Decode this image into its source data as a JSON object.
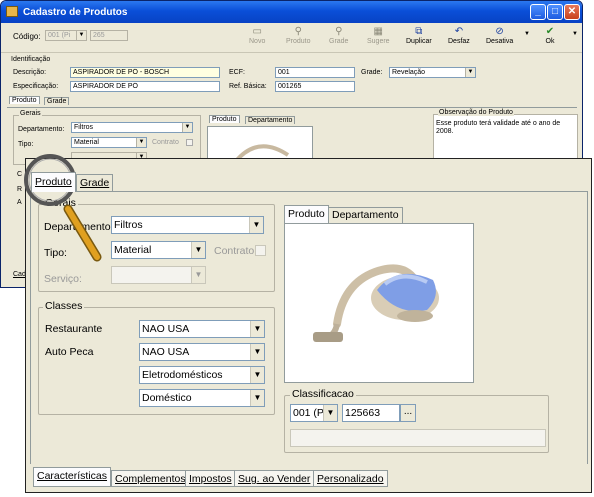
{
  "window": {
    "title": "Cadastro de Produtos",
    "min": "_",
    "max": "□",
    "close": "✕"
  },
  "toolbar": {
    "codigo_label": "Código:",
    "codigo_value": "001 (Pi",
    "codigo_num": "265",
    "buttons": [
      {
        "label": "Novo",
        "icon": "new-icon",
        "enabled": false
      },
      {
        "label": "Produto",
        "icon": "search-icon",
        "enabled": false
      },
      {
        "label": "Grade",
        "icon": "search-icon",
        "enabled": false
      },
      {
        "label": "Sugere",
        "icon": "grid-icon",
        "enabled": false
      },
      {
        "label": "Duplicar",
        "icon": "copy-icon",
        "enabled": true
      },
      {
        "label": "Desfaz",
        "icon": "undo-icon",
        "enabled": true
      },
      {
        "label": "Desativa",
        "icon": "disable-icon",
        "enabled": true
      },
      {
        "label": "Ok",
        "icon": "ok-icon",
        "enabled": true
      }
    ]
  },
  "identificacao": {
    "title": "Identificação",
    "descricao_label": "Descrição:",
    "descricao_value": "ASPIRADOR DE PÓ - BOSCH",
    "especificacao_label": "Especificação:",
    "especificacao_value": "ASPIRADOR DE PÓ",
    "ecf_label": "ECF:",
    "ecf_value": "001",
    "ref_label": "Ref. Básica:",
    "ref_value": "001265",
    "grade_label": "Grade:",
    "grade_value": "Revelação"
  },
  "bg_tabs": {
    "produto": "Produto",
    "grade": "Grade"
  },
  "bg_gerais": {
    "title": "Gerais",
    "departamento_label": "Departamento:",
    "departamento_value": "Filtros",
    "tipo_label": "Tipo:",
    "tipo_value": "Material",
    "contrato_label": "Contrato"
  },
  "bg_image_tabs": {
    "produto": "Produto",
    "departamento": "Departamento"
  },
  "observacao": {
    "title": "Observação do Produto",
    "text": "Esse produto terá validade até o ano de 2008."
  },
  "bg_cut_labels": {
    "c": "C",
    "r": "R",
    "a": "A",
    "cad": "Cad"
  },
  "zoom": {
    "tabs": {
      "produto": "Produto",
      "grade": "Grade"
    },
    "gerais": {
      "title": "Gerais",
      "departamento_label": "Departamento:",
      "departamento_value": "Filtros",
      "tipo_label": "Tipo:",
      "tipo_value": "Material",
      "contrato_label": "Contrato",
      "servico_label": "Serviço:"
    },
    "classes": {
      "title": "Classes",
      "rows": [
        {
          "label": "Restaurante",
          "value": "NAO USA"
        },
        {
          "label": "Auto Peca",
          "value": "NAO USA"
        },
        {
          "label": "",
          "value": "Eletrodomésticos"
        },
        {
          "label": "",
          "value": "Doméstico"
        }
      ]
    },
    "image_tabs": {
      "produto": "Produto",
      "departamento": "Departamento"
    },
    "classificacao": {
      "title": "Classificacao",
      "code": "001 (Pi",
      "number": "125663",
      "ellipsis": "..."
    },
    "bottom_tabs": [
      "Características",
      "Complementos",
      "Impostos",
      "Sug. ao Vender",
      "Personalizado"
    ]
  },
  "colors": {
    "titlebar": "#0a4fd8",
    "accent_ok": "#2a8a2a",
    "magnifier_handle": "#e0a020"
  }
}
